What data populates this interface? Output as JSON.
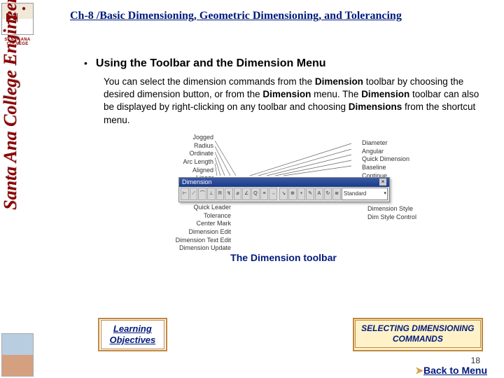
{
  "sidebar": {
    "logo_line1": "SANTA ANA",
    "logo_line2": "COLLEGE",
    "vertical_title": "Santa Ana College Engineering"
  },
  "header": {
    "chapter_title": "Ch-8 /Basic Dimensioning, Geometric Dimensioning, and Tolerancing"
  },
  "content": {
    "section_heading": "Using the Toolbar and the Dimension Menu",
    "body_parts": {
      "p1": "You can select the dimension commands from the ",
      "b1": "Dimension",
      "p2": " toolbar by choosing the desired dimension button, or from the ",
      "b2": "Dimension",
      "p3": " menu. The ",
      "b3": "Dimension",
      "p4": " toolbar can also be displayed by right-clicking on any toolbar and choosing ",
      "b4": "Dimensions",
      "p5": " from the shortcut menu."
    }
  },
  "diagram": {
    "top_left": [
      "Jogged",
      "Radius",
      "Ordinate",
      "Arc Length",
      "Aligned",
      "Linear"
    ],
    "top_right": [
      "Diameter",
      "Angular",
      "Quick Dimension",
      "Baseline",
      "Continue"
    ],
    "toolbar_title": "Dimension",
    "dropdown_value": "Standard",
    "bot_left": [
      "Quick Leader",
      "Tolerance",
      "Center Mark",
      "Dimension Edit",
      "Dimension Text Edit",
      "Dimension Update"
    ],
    "bot_right": [
      "Dimension Style",
      "Dim Style Control"
    ],
    "caption": "The Dimension toolbar"
  },
  "boxes": {
    "learning_l1": "Learning",
    "learning_l2": "Objectives",
    "right_l1": "SELECTING DIMENSIONING",
    "right_l2": "COMMANDS"
  },
  "footer": {
    "page_num": "18",
    "back_arrow": "➤",
    "back_text": "Back to Menu"
  }
}
